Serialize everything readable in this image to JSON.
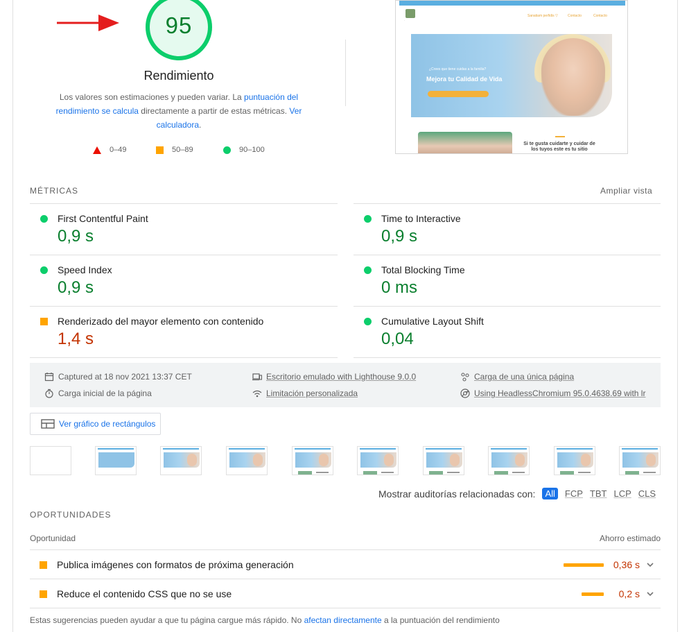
{
  "gauge": {
    "score": "95",
    "title": "Rendimiento",
    "desc_part1": "Los valores son estimaciones y pueden variar. La ",
    "desc_link1": "puntuación del rendimiento se calcula",
    "desc_part2": " directamente a partir de estas métricas. ",
    "desc_link2": "Ver calculadora",
    "desc_part3": ".",
    "score_fraction": 0.95,
    "color": "#0cce6b"
  },
  "legend": {
    "fail": "0–49",
    "average": "50–89",
    "pass": "90–100"
  },
  "screenshot": {
    "nav": [
      "Sanatiam perfidis ▽",
      "Contacto",
      "Contacto"
    ],
    "hero_small": "¿Crees que tiene cuidas a la familia?",
    "hero_title": "Mejora tu Calidad de Vida",
    "lower_text": "Si te gusta cuidarte y cuidar de los tuyos este es tu sitio"
  },
  "metrics": {
    "section_title": "MÉTRICAS",
    "expand_label": "Ampliar vista",
    "items": [
      {
        "label": "First Contentful Paint",
        "value": "0,9 s",
        "status": "pass"
      },
      {
        "label": "Time to Interactive",
        "value": "0,9 s",
        "status": "pass"
      },
      {
        "label": "Speed Index",
        "value": "0,9 s",
        "status": "pass"
      },
      {
        "label": "Total Blocking Time",
        "value": "0 ms",
        "status": "pass"
      },
      {
        "label": "Renderizado del mayor elemento con contenido",
        "value": "1,4 s",
        "status": "average"
      },
      {
        "label": "Cumulative Layout Shift",
        "value": "0,04",
        "status": "pass"
      }
    ]
  },
  "runtime": {
    "captured": "Captured at 18 nov 2021 13:37 CET",
    "initial_load": "Carga inicial de la página",
    "device": "Escritorio emulado with Lighthouse 9.0.0",
    "throttling": "Limitación personalizada",
    "single_page": "Carga de una única página",
    "browser": "Using HeadlessChromium 95.0.4638.69 with lr"
  },
  "treemap_button": "Ver gráfico de rectángulos",
  "filter": {
    "label": "Mostrar auditorías relacionadas con:",
    "chips": [
      "All",
      "FCP",
      "TBT",
      "LCP",
      "CLS"
    ],
    "active": "All"
  },
  "opportunities": {
    "section_title": "OPORTUNIDADES",
    "col_left": "Oportunidad",
    "col_right": "Ahorro estimado",
    "items": [
      {
        "label": "Publica imágenes con formatos de próxima generación",
        "value": "0,36 s",
        "savings_seconds": 0.36
      },
      {
        "label": "Reduce el contenido CSS que no se use",
        "value": "0,2 s",
        "savings_seconds": 0.2
      }
    ],
    "footnote_part1": "Estas sugerencias pueden ayudar a que tu página cargue más rápido. No ",
    "footnote_link": "afectan directamente",
    "footnote_part2": " a la puntuación del rendimiento"
  },
  "colors": {
    "pass": "#0cce6b",
    "average": "#ffa400",
    "fail": "#eb0f00",
    "link": "#1a73e8",
    "arrow": "#e41e1e"
  }
}
